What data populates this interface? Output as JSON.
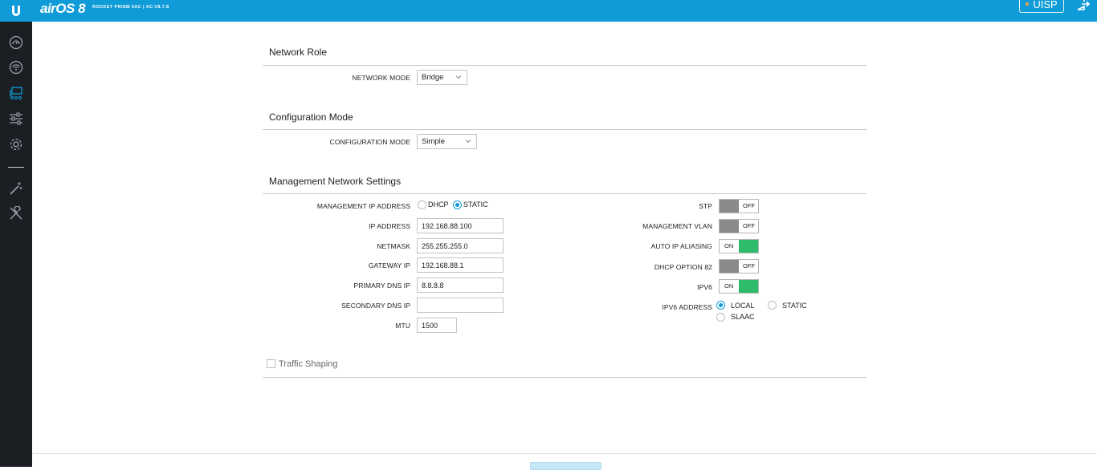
{
  "header": {
    "brand": "airOS 8",
    "device_info": "ROCKET PRISM 5AC | XC.V8.7.8",
    "uisp_label": "UISP",
    "colors": {
      "topbar": "#0f9bd7",
      "sidebar": "#1b1f24",
      "accent": "#0f9bd7",
      "on": "#2ebc6a",
      "off": "#8a8a8a"
    }
  },
  "sidebar": {
    "items": [
      {
        "icon": "dashboard-icon"
      },
      {
        "icon": "wireless-icon"
      },
      {
        "icon": "network-icon",
        "active": true
      },
      {
        "icon": "services-icon"
      },
      {
        "icon": "system-icon"
      },
      {
        "icon": "tools-wand-icon"
      },
      {
        "icon": "wrench-tools-icon"
      }
    ]
  },
  "network_role": {
    "title": "Network Role",
    "network_mode_label": "NETWORK MODE",
    "network_mode_value": "Bridge"
  },
  "configuration_mode": {
    "title": "Configuration Mode",
    "label": "CONFIGURATION MODE",
    "value": "Simple"
  },
  "management": {
    "title": "Management Network Settings",
    "ip_mode_label": "MANAGEMENT IP ADDRESS",
    "ip_mode_options": [
      "DHCP",
      "STATIC"
    ],
    "ip_mode_selected": "STATIC",
    "ip_address_label": "IP ADDRESS",
    "ip_address": "192.168.88.100",
    "netmask_label": "NETMASK",
    "netmask": "255.255.255.0",
    "gateway_label": "GATEWAY IP",
    "gateway": "192.168.88.1",
    "primary_dns_label": "PRIMARY DNS IP",
    "primary_dns": "8.8.8.8",
    "secondary_dns_label": "SECONDARY DNS IP",
    "secondary_dns": "",
    "mtu_label": "MTU",
    "mtu": "1500",
    "stp_label": "STP",
    "stp": "OFF",
    "mgmt_vlan_label": "MANAGEMENT VLAN",
    "mgmt_vlan": "OFF",
    "auto_ip_label": "AUTO IP ALIASING",
    "auto_ip": "ON",
    "dhcp82_label": "DHCP OPTION 82",
    "dhcp82": "OFF",
    "ipv6_label": "IPV6",
    "ipv6": "ON",
    "ipv6_addr_label": "IPV6 ADDRESS",
    "ipv6_addr_options": [
      "LOCAL",
      "STATIC",
      "SLAAC"
    ],
    "ipv6_addr_selected": "LOCAL"
  },
  "traffic_shaping": {
    "label": "Traffic Shaping",
    "checked": false
  }
}
